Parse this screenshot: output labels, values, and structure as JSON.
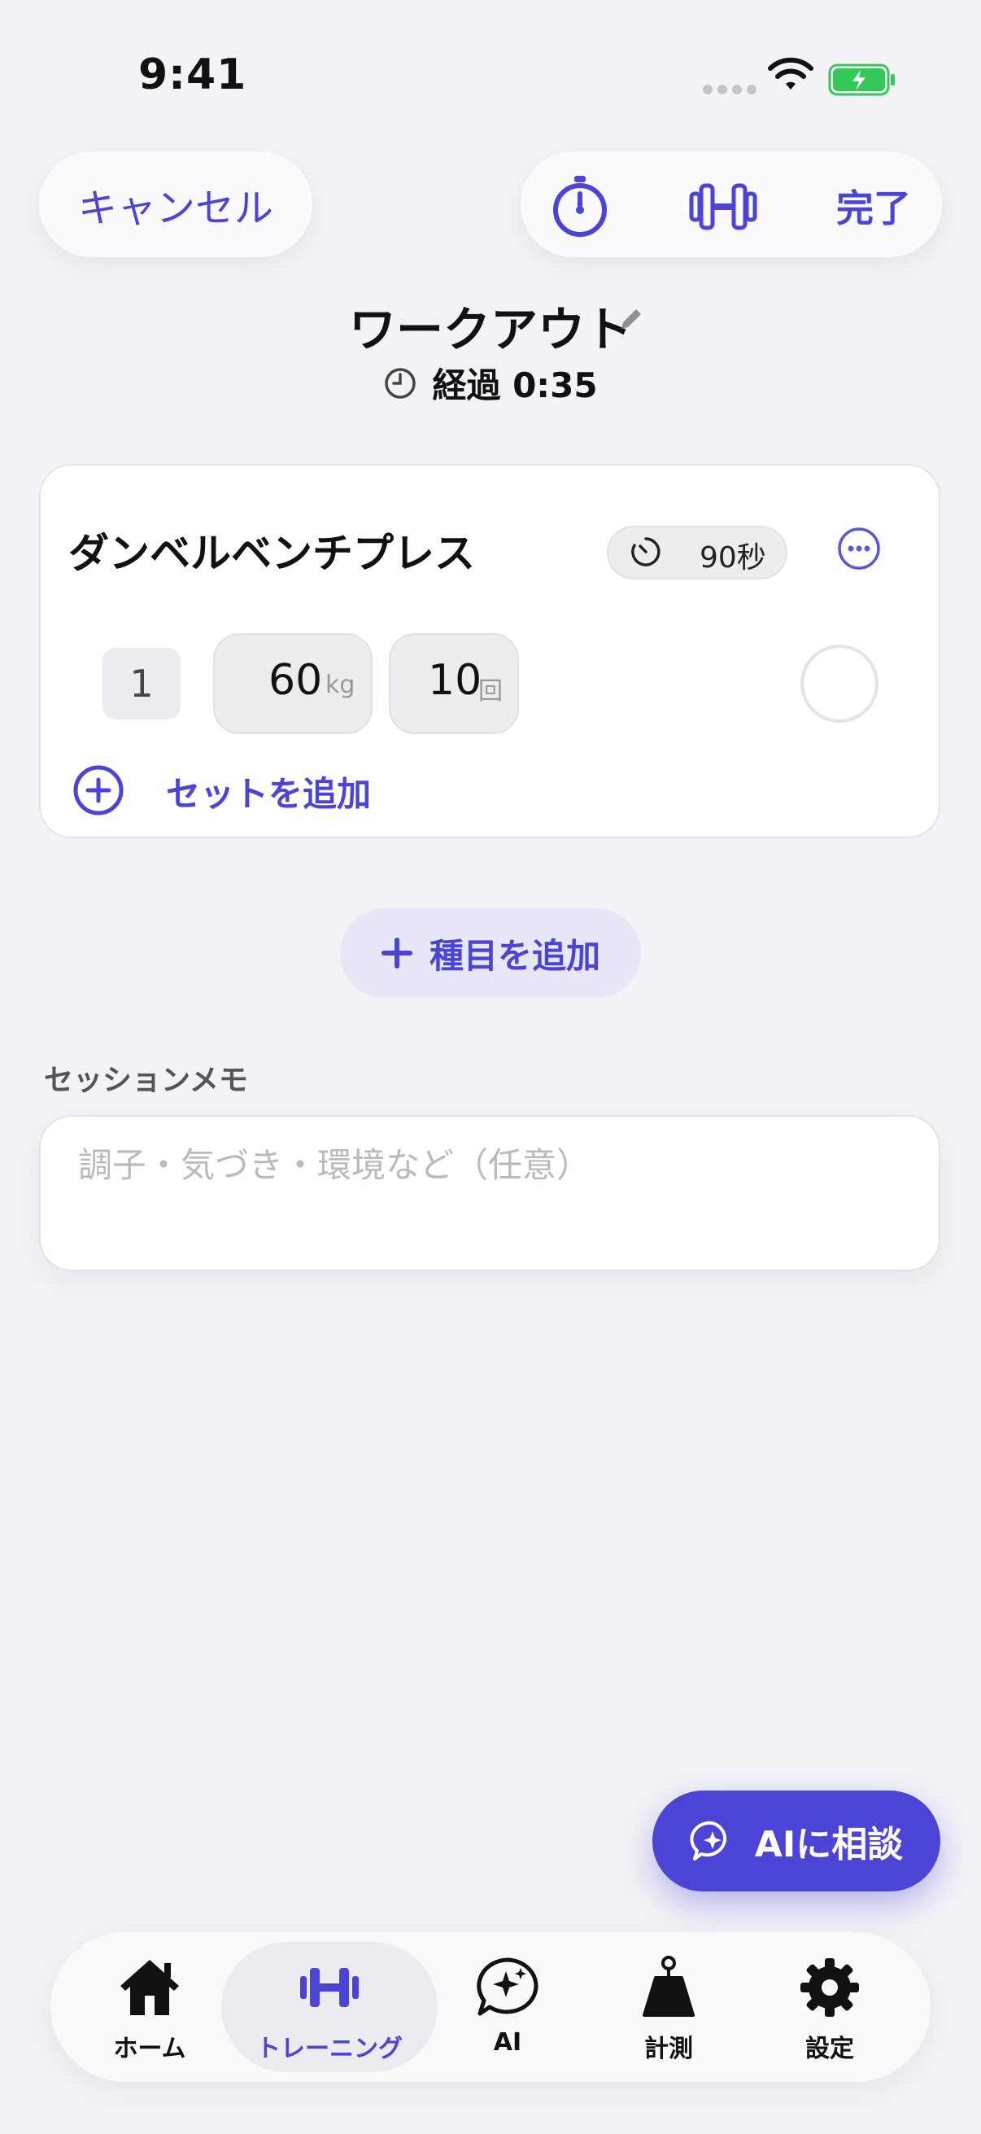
{
  "status_bar": {
    "time": "9:41"
  },
  "header": {
    "cancel_label": "キャンセル",
    "done_label": "完了",
    "title": "ワークアウト",
    "elapsed": "経過 0:35"
  },
  "exercise": {
    "name": "ダンベルベンチプレス",
    "rest": "90秒",
    "sets": [
      {
        "number": "1",
        "weight": "60",
        "weight_unit": "kg",
        "reps": "10",
        "reps_unit": "回",
        "completed": false
      }
    ],
    "add_set_label": "セットを追加"
  },
  "add_exercise_label": "種目を追加",
  "memo": {
    "label": "セッションメモ",
    "placeholder": "調子・気づき・環境など（任意）",
    "value": ""
  },
  "ai_button_label": "AIに相談",
  "tabbar": {
    "items": [
      {
        "label": "ホーム",
        "icon": "house-icon",
        "active": false
      },
      {
        "label": "トレーニング",
        "icon": "dumbbell-icon",
        "active": true
      },
      {
        "label": "AI",
        "icon": "ai-sparkle-chat-icon",
        "active": false
      },
      {
        "label": "計測",
        "icon": "kettlebell-scale-icon",
        "active": false
      },
      {
        "label": "設定",
        "icon": "gear-icon",
        "active": false
      }
    ]
  },
  "colors": {
    "accent": "#4b44d6",
    "background": "#f2f2f7",
    "battery_green": "#34c759"
  }
}
